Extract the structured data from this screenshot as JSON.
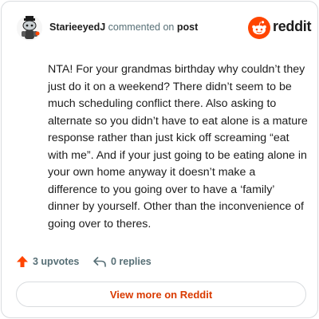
{
  "comment": {
    "author": "StarieeyedJ",
    "action_text": "commented on",
    "target": "post",
    "body": "NTA! For your grandmas birthday why couldn’t they just do it on a weekend? There didn’t seem to be much scheduling conflict there. Also asking to alternate so you didn’t have to eat alone is a mature response rather than just kick off screaming “eat with me”. And if your just going to be eating alone in your own home anyway it doesn’t make a difference to you going over to have a ‘family’ dinner by yourself. Other than the inconvenience of going over to theres."
  },
  "brand": {
    "name": "reddit",
    "color": "#ff4500"
  },
  "stats": {
    "upvotes_label": "3 upvotes",
    "replies_label": "0 replies"
  },
  "footer": {
    "view_more_label": "View more on Reddit"
  },
  "colors": {
    "accent": "#d93a00",
    "upvote": "#ff4500",
    "muted": "#576f76",
    "border": "#d9dcdf"
  },
  "icons": {
    "avatar": "snoo-avatar",
    "upvote": "upvote-arrow-icon",
    "reply": "reply-icon",
    "logo": "reddit-logo-icon"
  }
}
